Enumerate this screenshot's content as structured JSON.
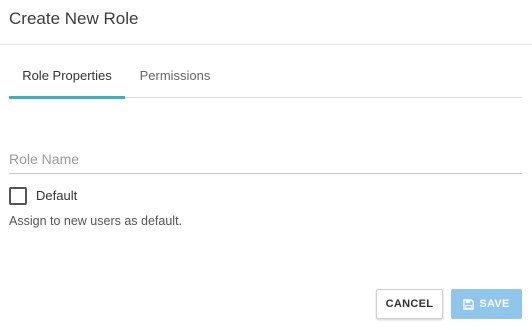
{
  "dialog": {
    "title": "Create New Role"
  },
  "tabs": [
    {
      "label": "Role Properties",
      "active": true
    },
    {
      "label": "Permissions",
      "active": false
    }
  ],
  "form": {
    "role_name": {
      "value": "",
      "placeholder": "Role Name"
    },
    "default_checkbox": {
      "label": "Default",
      "checked": false
    },
    "helper_text": "Assign to new users as default."
  },
  "actions": {
    "cancel_label": "CANCEL",
    "save_label": "SAVE",
    "save_icon": "floppy-disk-icon"
  },
  "colors": {
    "accent": "#3bb3bf",
    "save_button": "#90c5ec"
  }
}
